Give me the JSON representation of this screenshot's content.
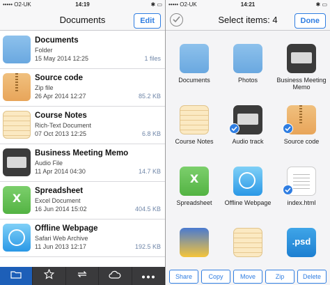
{
  "left": {
    "status": {
      "carrier": "••••• O2-UK",
      "time": "14:19",
      "battery": "✱ ▭"
    },
    "nav": {
      "title": "Documents",
      "edit_label": "Edit"
    },
    "rows": [
      {
        "name": "Documents",
        "type": "Folder",
        "date": "15 May 2014 12:25",
        "size": "1 files",
        "icon": "folder-icon"
      },
      {
        "name": "Source code",
        "type": "Zip file",
        "date": "26 Apr 2014 12:27",
        "size": "85.2 KB",
        "icon": "zip-icon"
      },
      {
        "name": "Course Notes",
        "type": "Rich-Text Document",
        "date": "07 Oct 2013 12:25",
        "size": "6.8 KB",
        "icon": "notes-icon"
      },
      {
        "name": "Business Meeting Memo",
        "type": "Audio File",
        "date": "11 Apr 2014 04:30",
        "size": "14.7 KB",
        "icon": "audio-icon"
      },
      {
        "name": "Spreadsheet",
        "type": "Excel Document",
        "date": "16 Jun 2014 15:02",
        "size": "404.5 KB",
        "icon": "spreadsheet-icon"
      },
      {
        "name": "Offline Webpage",
        "type": "Safari Web Archive",
        "date": "11 Jun 2013 12:17",
        "size": "192.5 KB",
        "icon": "safari-icon"
      }
    ],
    "tabs": [
      "folder-icon",
      "star-icon",
      "sync-icon",
      "cloud-icon",
      "more-icon"
    ]
  },
  "right": {
    "status": {
      "carrier": "••••• O2-UK",
      "time": "14:21",
      "battery": "✱ ▭"
    },
    "nav": {
      "title": "Select items: 4",
      "done_label": "Done"
    },
    "items": [
      {
        "label": "Documents",
        "icon": "folder-icon",
        "selected": false
      },
      {
        "label": "Photos",
        "icon": "folder-icon",
        "selected": false
      },
      {
        "label": "Business Meeting Memo",
        "icon": "audio-icon",
        "selected": false
      },
      {
        "label": "Course Notes",
        "icon": "notes-icon",
        "selected": false
      },
      {
        "label": "Audio track",
        "icon": "audio-icon",
        "selected": true
      },
      {
        "label": "Source code",
        "icon": "zip-icon",
        "selected": true
      },
      {
        "label": "Spreadsheet",
        "icon": "spreadsheet-icon",
        "selected": false
      },
      {
        "label": "Offline Webpage",
        "icon": "safari-icon",
        "selected": false
      },
      {
        "label": "index.html",
        "icon": "html-icon",
        "selected": true
      },
      {
        "label": "",
        "icon": "photo-icon",
        "selected": false
      },
      {
        "label": "",
        "icon": "notes-icon",
        "selected": false
      },
      {
        "label": ".psd",
        "icon": "psd-icon",
        "selected": false
      }
    ],
    "actions": [
      "Share",
      "Copy",
      "Move",
      "Zip",
      "Delete"
    ]
  }
}
